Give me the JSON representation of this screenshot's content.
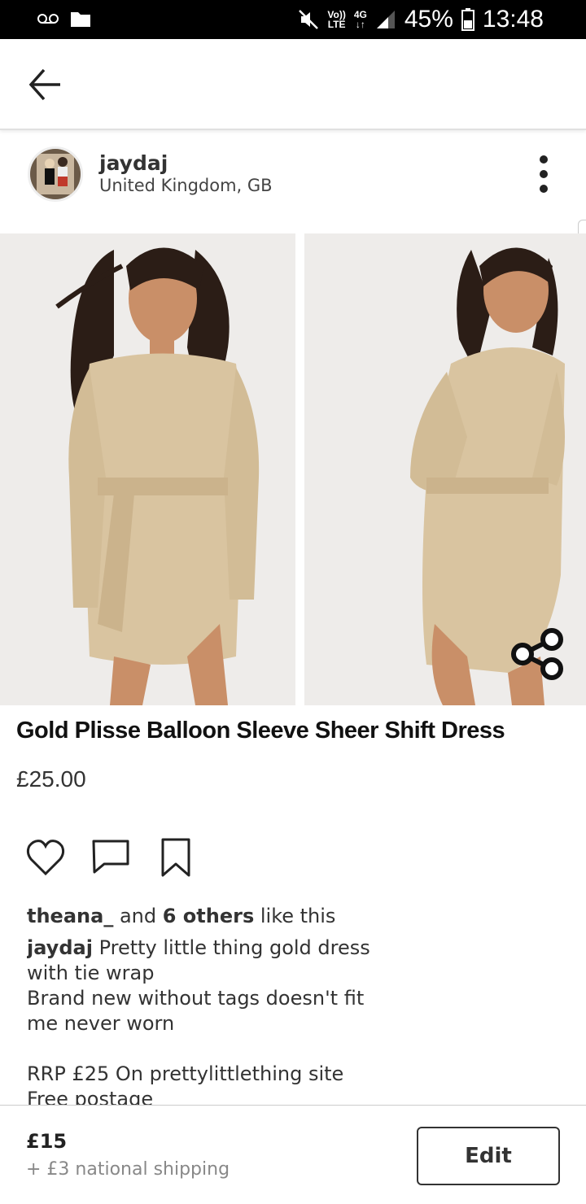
{
  "status_bar": {
    "battery": "45%",
    "time": "13:48",
    "volte_top": "Vo))",
    "volte_bottom": "LTE",
    "network": "4G",
    "icons": [
      "voicemail-icon",
      "file-icon",
      "mute-icon",
      "signal-icon",
      "battery-icon"
    ]
  },
  "header": {
    "back_icon": "arrow-left-icon"
  },
  "seller": {
    "username": "jaydaj",
    "location": "United Kingdom, GB"
  },
  "product": {
    "title": "Gold Plisse Balloon Sleeve Sheer Shift Dress",
    "price": "£25.00"
  },
  "actions": {
    "icons": [
      "heart-icon",
      "comment-icon",
      "bookmark-icon"
    ]
  },
  "likes": {
    "user": "theana_",
    "and": " and ",
    "others": "6 others",
    "suffix": " like this"
  },
  "description": {
    "author": "jaydaj",
    "line1": " Pretty little thing gold dress\nwith tie wrap",
    "line2": "Brand new without tags doesn't fit\nme never worn",
    "line3": "RRP £25 On prettylittlething site",
    "line4": "Free postage"
  },
  "listing": {
    "price": "£15",
    "shipping": "+ £3 national shipping",
    "edit_label": "Edit"
  },
  "colors": {
    "status_bar": "#000000",
    "dress_gold": "#d9c4a0",
    "background": "#ffffff"
  }
}
